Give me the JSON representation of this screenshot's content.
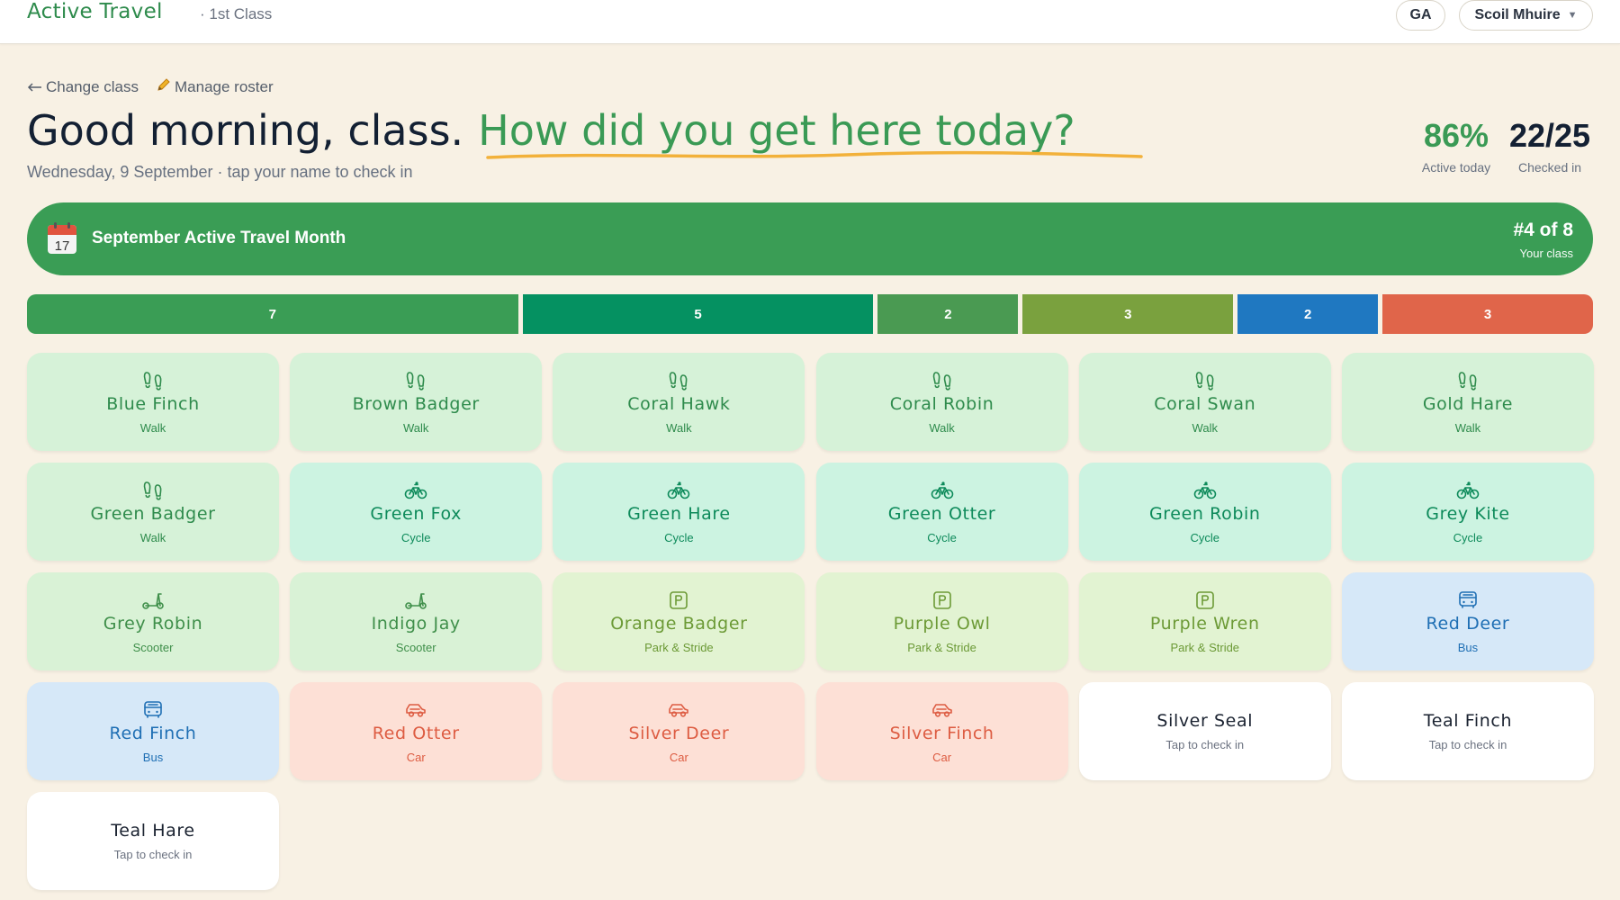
{
  "header": {
    "app_title": "Active Travel",
    "class_label": "· 1st Class",
    "user_initials": "GA",
    "school_name": "Scoil Mhuire",
    "school_caret": "▼"
  },
  "nav": {
    "change_class": "Change class",
    "manage_roster": "Manage roster"
  },
  "greeting": {
    "text": "Good morning, class.",
    "question": "How did you get here today?",
    "date_line": "Wednesday, 9 September · tap your name to check in"
  },
  "stats": {
    "active_pct": "86%",
    "active_label": "Active today",
    "checked_in": "22/25",
    "checked_label": "Checked in"
  },
  "banner": {
    "calendar_day": "17",
    "title": "September Active Travel Month",
    "rank": "#4 of 8",
    "rank_label": "Your class"
  },
  "modes": [
    {
      "mode": "walk",
      "count": 7,
      "color": "#3a9d55"
    },
    {
      "mode": "cycle",
      "count": 5,
      "color": "#059161"
    },
    {
      "mode": "scooter",
      "count": 2,
      "color": "#4a9a52"
    },
    {
      "mode": "park",
      "count": 3,
      "color": "#7aa13e"
    },
    {
      "mode": "bus",
      "count": 2,
      "color": "#1f78c1"
    },
    {
      "mode": "car",
      "count": 3,
      "color": "#e0654a"
    }
  ],
  "students": [
    {
      "name": "Blue Finch",
      "mode": "walk",
      "mode_label": "Walk"
    },
    {
      "name": "Brown Badger",
      "mode": "walk",
      "mode_label": "Walk"
    },
    {
      "name": "Coral Hawk",
      "mode": "walk",
      "mode_label": "Walk"
    },
    {
      "name": "Coral Robin",
      "mode": "walk",
      "mode_label": "Walk"
    },
    {
      "name": "Coral Swan",
      "mode": "walk",
      "mode_label": "Walk"
    },
    {
      "name": "Gold Hare",
      "mode": "walk",
      "mode_label": "Walk"
    },
    {
      "name": "Green Badger",
      "mode": "walk",
      "mode_label": "Walk"
    },
    {
      "name": "Green Fox",
      "mode": "cycle",
      "mode_label": "Cycle"
    },
    {
      "name": "Green Hare",
      "mode": "cycle",
      "mode_label": "Cycle"
    },
    {
      "name": "Green Otter",
      "mode": "cycle",
      "mode_label": "Cycle"
    },
    {
      "name": "Green Robin",
      "mode": "cycle",
      "mode_label": "Cycle"
    },
    {
      "name": "Grey Kite",
      "mode": "cycle",
      "mode_label": "Cycle"
    },
    {
      "name": "Grey Robin",
      "mode": "scooter",
      "mode_label": "Scooter"
    },
    {
      "name": "Indigo Jay",
      "mode": "scooter",
      "mode_label": "Scooter"
    },
    {
      "name": "Orange Badger",
      "mode": "park",
      "mode_label": "Park & Stride"
    },
    {
      "name": "Purple Owl",
      "mode": "park",
      "mode_label": "Park & Stride"
    },
    {
      "name": "Purple Wren",
      "mode": "park",
      "mode_label": "Park & Stride"
    },
    {
      "name": "Red Deer",
      "mode": "bus",
      "mode_label": "Bus"
    },
    {
      "name": "Red Finch",
      "mode": "bus",
      "mode_label": "Bus"
    },
    {
      "name": "Red Otter",
      "mode": "car",
      "mode_label": "Car"
    },
    {
      "name": "Silver Deer",
      "mode": "car",
      "mode_label": "Car"
    },
    {
      "name": "Silver Finch",
      "mode": "car",
      "mode_label": "Car"
    },
    {
      "name": "Silver Seal",
      "mode": "none",
      "mode_label": "Tap to check in"
    },
    {
      "name": "Teal Finch",
      "mode": "none",
      "mode_label": "Tap to check in"
    },
    {
      "name": "Teal Hare",
      "mode": "none",
      "mode_label": "Tap to check in"
    }
  ],
  "mode_styles": {
    "walk": {
      "bg": "#d6f2d8",
      "fg": "#2e8b4c",
      "icon": "footprints-icon"
    },
    "cycle": {
      "bg": "#ccf3e1",
      "fg": "#0d8a5a",
      "icon": "bicycle-icon"
    },
    "scooter": {
      "bg": "#d9f2d6",
      "fg": "#3f8f4a",
      "icon": "scooter-icon"
    },
    "park": {
      "bg": "#e2f3d2",
      "fg": "#6c9a36",
      "icon": "parking-icon"
    },
    "bus": {
      "bg": "#d6e8f8",
      "fg": "#1f6fb4",
      "icon": "bus-icon"
    },
    "car": {
      "bg": "#fde0d6",
      "fg": "#dd5c42",
      "icon": "car-icon"
    },
    "none": {
      "bg": "#ffffff",
      "fg": "#1b2331",
      "icon": ""
    }
  }
}
